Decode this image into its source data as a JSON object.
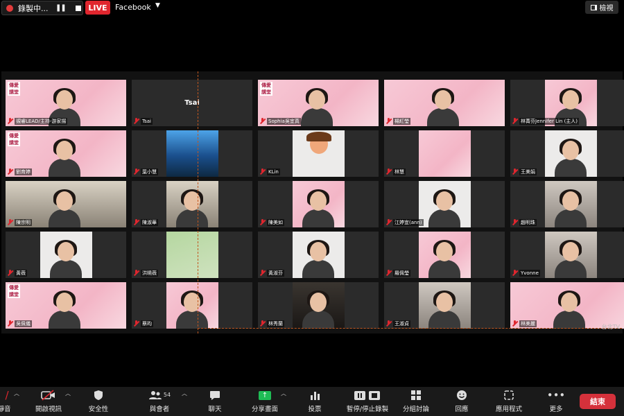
{
  "topbar": {
    "recording_label": "錄製中...",
    "live_badge": "LIVE",
    "stream_target": "Facebook",
    "view_label": "檢視"
  },
  "tiles": [
    {
      "name": "覬睿LEAD/主持-游家揚",
      "bg": "pink",
      "logo": true,
      "person": true,
      "active": true
    },
    {
      "name": "Tsai",
      "center": "Tsai"
    },
    {
      "name": "Sophia吳宜真",
      "bg": "pink",
      "logo": true,
      "person": true
    },
    {
      "name": "楊紅瑩",
      "bg": "pink",
      "person": true
    },
    {
      "name": "林菁芬Jennifer Lin (主人)",
      "bg": "pink",
      "person": true,
      "mid": true
    },
    {
      "name": "劉育婷",
      "bg": "pink",
      "logo": true,
      "person": true
    },
    {
      "name": "葉小慧",
      "bg": "blue",
      "mid": true
    },
    {
      "name": "KLin",
      "bg": "light",
      "cartoon": true,
      "mid": true
    },
    {
      "name": "林慧",
      "bg": "pink",
      "mid": true
    },
    {
      "name": "王美娟",
      "bg": "light",
      "person": true,
      "mid": true
    },
    {
      "name": "陳宗明",
      "bg": "room",
      "person": true
    },
    {
      "name": "陳淑華",
      "bg": "room",
      "person": true,
      "mid": true
    },
    {
      "name": "陳美如",
      "bg": "pink",
      "person": true,
      "mid": true
    },
    {
      "name": "江婷宜(ann)",
      "bg": "light",
      "person": true,
      "mid": true
    },
    {
      "name": "趙明珠",
      "bg": "grey",
      "person": true,
      "mid": true
    },
    {
      "name": "黃薇",
      "bg": "light",
      "person": true,
      "mid": true
    },
    {
      "name": "洪曉薇",
      "bg": "green",
      "mid": true
    },
    {
      "name": "黃淑芬",
      "bg": "light",
      "person": true,
      "mid": true
    },
    {
      "name": "羅佩瑩",
      "bg": "pink",
      "person": true,
      "mid": true
    },
    {
      "name": "Yvonne",
      "bg": "grey",
      "person": true,
      "mid": true
    },
    {
      "name": "吳佩儀",
      "bg": "pink",
      "logo": true,
      "person": true
    },
    {
      "name": "蔡昀",
      "bg": "pink",
      "person": true,
      "mid": true
    },
    {
      "name": "林秀蘭",
      "bg": "dark",
      "person": true,
      "mid": true
    },
    {
      "name": "王淑貞",
      "bg": "grey",
      "person": true,
      "mid": true
    },
    {
      "name": "林美麗",
      "bg": "pink",
      "person": true
    }
  ],
  "logo_text": "傳愛講堂",
  "watermark": "台北TV",
  "toolbar": {
    "unmute_label": "靜音",
    "video_label": "開啟視訊",
    "security_label": "安全性",
    "participants_label": "與會者",
    "participants_count": "54",
    "chat_label": "聊天",
    "share_label": "分享畫面",
    "polls_label": "投票",
    "record_label": "暫停/停止錄製",
    "breakout_label": "分組討論",
    "reactions_label": "回應",
    "apps_label": "應用程式",
    "more_label": "更多",
    "end_label": "結束"
  },
  "colors": {
    "live_red": "#e0262e",
    "active_speaker": "#a6d936",
    "share_green": "#1fbc55",
    "end_red": "#d5313b"
  }
}
